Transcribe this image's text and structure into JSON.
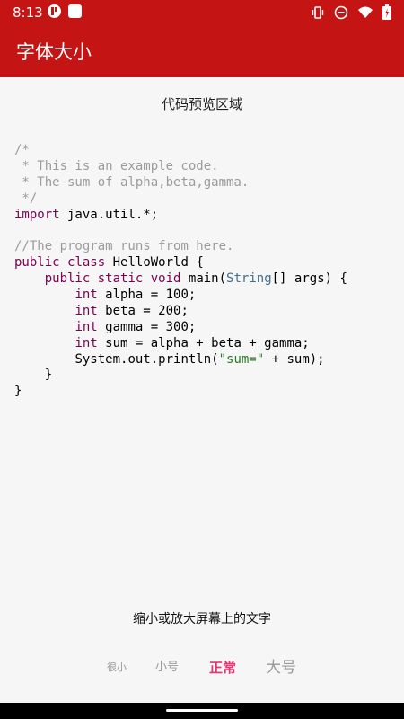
{
  "status_bar": {
    "time": "8:13",
    "left_icons": [
      "app-notification-icon",
      "app-square-icon"
    ],
    "right_icons": [
      "vibrate-icon",
      "do-not-disturb-icon",
      "wifi-icon",
      "battery-icon"
    ]
  },
  "app_bar": {
    "title": "字体大小",
    "color": "#c41414"
  },
  "preview": {
    "title": "代码预览区域",
    "code_lines": [
      "/*",
      " * This is an example code.",
      " * The sum of alpha,beta,gamma.",
      " */",
      "import java.util.*;",
      "",
      "//The program runs from here.",
      "public class HelloWorld {",
      "    public static void main(String[] args) {",
      "        int alpha = 100;",
      "        int beta = 200;",
      "        int gamma = 300;",
      "        int sum = alpha + beta + gamma;",
      "        System.out.println(\"sum=\" + sum);",
      "    }",
      "}"
    ],
    "code_tokens": {
      "import": "import",
      "import_rest": " java.util.*;",
      "public": "public",
      "class": "class",
      "class_rest": " HelloWorld {",
      "static": "static",
      "void": "void",
      "main_open": " main(",
      "String": "String",
      "args_rest": "[] args) {",
      "int": "int",
      "alpha_rest": " alpha = 100;",
      "beta_rest": " beta = 200;",
      "gamma_rest": " gamma = 300;",
      "sum_rest": " sum = alpha + beta + gamma;",
      "println_open": "System.out.println(",
      "sum_str": "\"sum=\"",
      "println_close": " + sum);",
      "indent4": "    ",
      "indent8": "        "
    }
  },
  "hint": "缩小或放大屏幕上的文字",
  "size_options": [
    {
      "label": "很小",
      "selected": false
    },
    {
      "label": "小号",
      "selected": false
    },
    {
      "label": "正常",
      "selected": true
    },
    {
      "label": "大号",
      "selected": false
    }
  ],
  "colors": {
    "accent": "#e8326e",
    "comment": "#9b9b9b",
    "keyword": "#7b0052",
    "type": "#3f6f8f",
    "string": "#2a7a2a"
  }
}
